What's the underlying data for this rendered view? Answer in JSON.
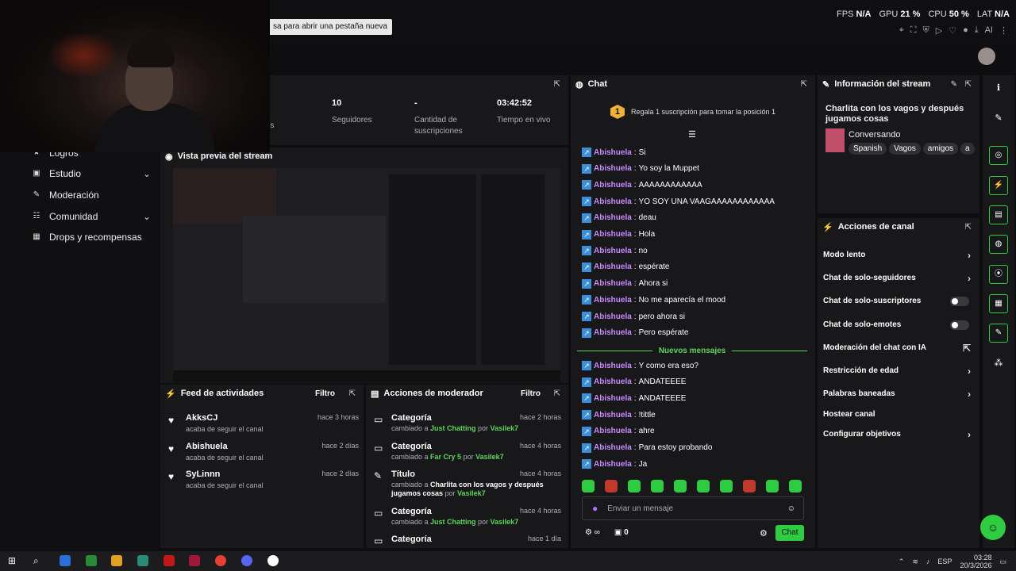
{
  "tooltip": "sa para abrir una pestaña nueva",
  "perf": {
    "fps_label": "FPS",
    "fps": "N/A",
    "gpu_label": "GPU",
    "gpu": "21 %",
    "cpu_label": "CPU",
    "cpu": "50 %",
    "lat_label": "LAT",
    "lat": "N/A"
  },
  "nav": {
    "items": [
      "Logros",
      "Estudio",
      "Moderación",
      "Comunidad",
      "Drops y recompensas"
    ]
  },
  "stats": {
    "partial_label": "tadores",
    "followers": {
      "value": "10",
      "label": "Seguidores"
    },
    "subs": {
      "value": "-",
      "label": "Cantidad de suscripciones"
    },
    "uptime": {
      "value": "03:42:52",
      "label": "Tiempo en vivo"
    }
  },
  "preview": {
    "title": "Vista previa del stream"
  },
  "feed": {
    "title": "Feed de actividades",
    "filter": "Filtro",
    "items": [
      {
        "name": "AkksCJ",
        "sub": "acaba de seguir el canal",
        "time": "hace 3 horas"
      },
      {
        "name": "Abishuela",
        "sub": "acaba de seguir el canal",
        "time": "hace 2 días"
      },
      {
        "name": "SyLinnn",
        "sub": "acaba de seguir el canal",
        "time": "hace 2 días"
      }
    ]
  },
  "modactions": {
    "title": "Acciones de moderador",
    "filter": "Filtro",
    "items": [
      {
        "name": "Categoría",
        "pre": "cambiado a ",
        "val": "Just Chatting",
        "by": " por ",
        "user": "Vasilek7",
        "time": "hace 2 horas"
      },
      {
        "name": "Categoría",
        "pre": "cambiado a ",
        "val": "Far Cry 5",
        "by": " por ",
        "user": "Vasilek7",
        "time": "hace 4 horas"
      },
      {
        "name": "Título",
        "pre": "cambiado a ",
        "val": "Charlita con los vagos y después jugamos cosas",
        "by": " por ",
        "user": "Vasilek7",
        "time": "hace 4 horas"
      },
      {
        "name": "Categoría",
        "pre": "cambiado a ",
        "val": "Just Chatting",
        "by": " por ",
        "user": "Vasilek7",
        "time": "hace 4 horas"
      },
      {
        "name": "Categoría",
        "pre": "",
        "val": "",
        "by": "",
        "user": "",
        "time": "hace 1 día"
      }
    ]
  },
  "chat": {
    "title": "Chat",
    "gift_rank": "1",
    "gift_text": "Regala 1 suscripción para tomar la posición 1",
    "messages": [
      {
        "user": "Abishuela",
        "text": "Si"
      },
      {
        "user": "Abishuela",
        "text": "Yo soy la Muppet"
      },
      {
        "user": "Abishuela",
        "text": "AAAAAAAAAAAA"
      },
      {
        "user": "Abishuela",
        "text": "YO SOY UNA VAAGAAAAAAAAAAAA"
      },
      {
        "user": "Abishuela",
        "text": "deau"
      },
      {
        "user": "Abishuela",
        "text": "Hola"
      },
      {
        "user": "Abishuela",
        "text": "no"
      },
      {
        "user": "Abishuela",
        "text": "espérate"
      },
      {
        "user": "Abishuela",
        "text": "Ahora si"
      },
      {
        "user": "Abishuela",
        "text": "No me aparecía el mood"
      },
      {
        "user": "Abishuela",
        "text": "pero ahora si"
      },
      {
        "user": "Abishuela",
        "text": "Pero espérate"
      }
    ],
    "new_label": "Nuevos mensajes",
    "new_messages": [
      {
        "user": "Abishuela",
        "text": "Y como era eso?"
      },
      {
        "user": "Abishuela",
        "text": "ANDATEEEE"
      },
      {
        "user": "Abishuela",
        "text": "ANDATEEEE"
      },
      {
        "user": "Abishuela",
        "text": "!tittle"
      },
      {
        "user": "Abishuela",
        "text": "ahre"
      },
      {
        "user": "Abishuela",
        "text": "Para estoy probando"
      },
      {
        "user": "Abishuela",
        "text": "Ja"
      }
    ],
    "placeholder": "Enviar un mensaje",
    "points": "0",
    "send": "Chat"
  },
  "info": {
    "title": "Información del stream",
    "stream_title": "Charlita con los vagos y después jugamos cosas",
    "category": "Conversando",
    "tags": [
      "Spanish",
      "Vagos",
      "amigos",
      "a"
    ]
  },
  "actions": {
    "title": "Acciones de canal",
    "rows": [
      "Modo lento",
      "Chat de solo-seguidores",
      "Chat de solo-suscriptores",
      "Chat de solo-emotes",
      "Moderación del chat con IA",
      "Restricción de edad",
      "Palabras baneadas",
      "Hostear canal",
      "Configurar objetivos"
    ]
  },
  "taskbar": {
    "lang": "ESP",
    "time": "03:28",
    "date": "20/3/2026"
  },
  "colors": {
    "accent": "#2ecc40",
    "username": "#c88bff",
    "bg": "#18181b"
  }
}
